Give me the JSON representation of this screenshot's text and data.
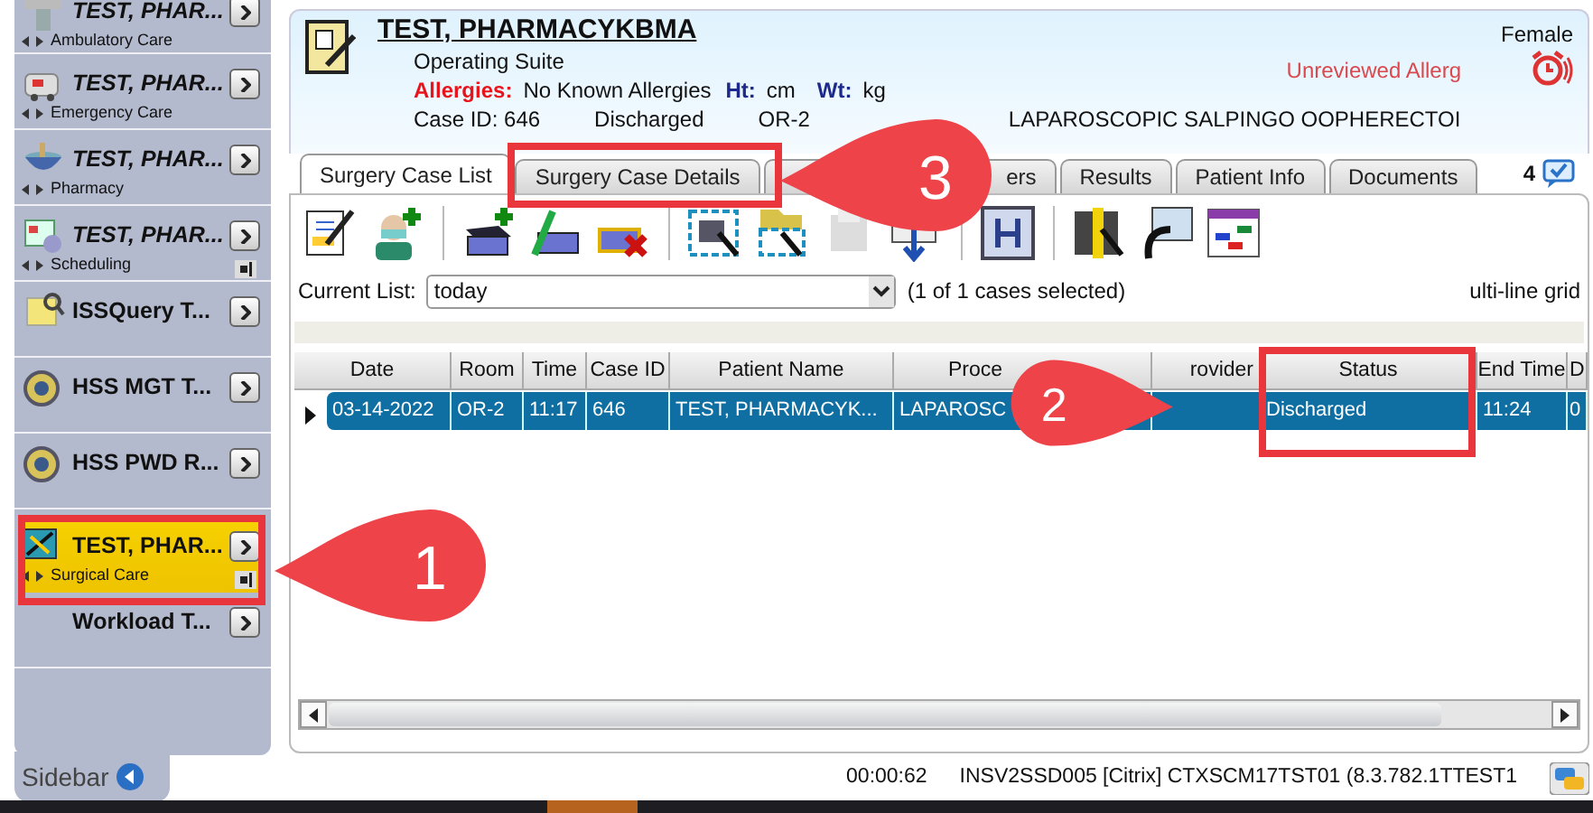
{
  "sidebar": {
    "items": [
      {
        "kind": "cross",
        "title": "TEST, PHAR...",
        "subtitle": "Ambulatory Care",
        "italic": true,
        "selected": false,
        "pinned": false
      },
      {
        "kind": "ambulance",
        "title": "TEST, PHAR...",
        "subtitle": "Emergency Care",
        "italic": true,
        "selected": false,
        "pinned": false
      },
      {
        "kind": "bowl",
        "title": "TEST, PHAR...",
        "subtitle": "Pharmacy",
        "italic": true,
        "selected": false,
        "pinned": false
      },
      {
        "kind": "calendar",
        "title": "TEST, PHAR...",
        "subtitle": "Scheduling",
        "italic": true,
        "selected": false,
        "pinned": true
      },
      {
        "kind": "note",
        "title": "ISSQuery T...",
        "italic": false,
        "selected": false,
        "pinned": false
      },
      {
        "kind": "gear",
        "title": "HSS MGT T...",
        "italic": false,
        "selected": false,
        "pinned": false
      },
      {
        "kind": "gear",
        "title": "HSS PWD R...",
        "italic": false,
        "selected": false,
        "pinned": false
      },
      {
        "kind": "surgery",
        "title": "TEST, PHAR...",
        "subtitle": "Surgical Care",
        "italic": false,
        "selected": true,
        "pinned": true
      },
      {
        "kind": "blank",
        "title": "Workload T...",
        "italic": false,
        "selected": false,
        "pinned": false
      }
    ],
    "footer": "Sidebar"
  },
  "header": {
    "name": "TEST, PHARMACYKBMA",
    "location": "Operating Suite",
    "allergies_label": "Allergies:",
    "allergies": "No Known Allergies",
    "ht_label": "Ht:",
    "ht_unit": "cm",
    "wt_label": "Wt:",
    "wt_unit": "kg",
    "case_id": "Case ID: 646",
    "status": "Discharged",
    "room": "OR-2",
    "procedure": "LAPAROSCOPIC SALPINGO OOPHERECTOI",
    "sex": "Female",
    "alert": "Unreviewed Allerg"
  },
  "tabs": [
    {
      "label": "Surgery Case List",
      "selected": true
    },
    {
      "label": "Surgery Case Details",
      "selected": false
    },
    {
      "selected": false
    },
    {
      "label": "ers",
      "selected": false
    },
    {
      "label": "Results",
      "selected": false
    },
    {
      "label": "Patient Info",
      "selected": false
    },
    {
      "label": "Documents",
      "selected": false
    }
  ],
  "message_count": "4",
  "current_list": {
    "label": "Current List:",
    "value": "today",
    "selection": "(1 of 1 cases selected)",
    "grid_option": "ulti-line grid"
  },
  "table": {
    "columns": [
      "Date",
      "Room",
      "Time",
      "Case ID",
      "Patient Name",
      "Proce",
      "rovider",
      "Status",
      "End Time",
      "D"
    ],
    "rows": [
      {
        "selected": true,
        "cells": [
          "03-14-2022",
          "OR-2",
          "11:17",
          "646",
          "TEST, PHARMACYK...",
          "LAPAROSC",
          null,
          "Discharged",
          "11:24",
          "0"
        ]
      }
    ]
  },
  "status_bar": {
    "timer": "00:00:62",
    "server": "INSV2SSD005 [Citrix] CTXSCM17TST01 (8.3.782.1",
    "user": "TTEST1"
  },
  "callouts": [
    {
      "label": "1"
    },
    {
      "label": "2"
    },
    {
      "label": "3"
    }
  ]
}
